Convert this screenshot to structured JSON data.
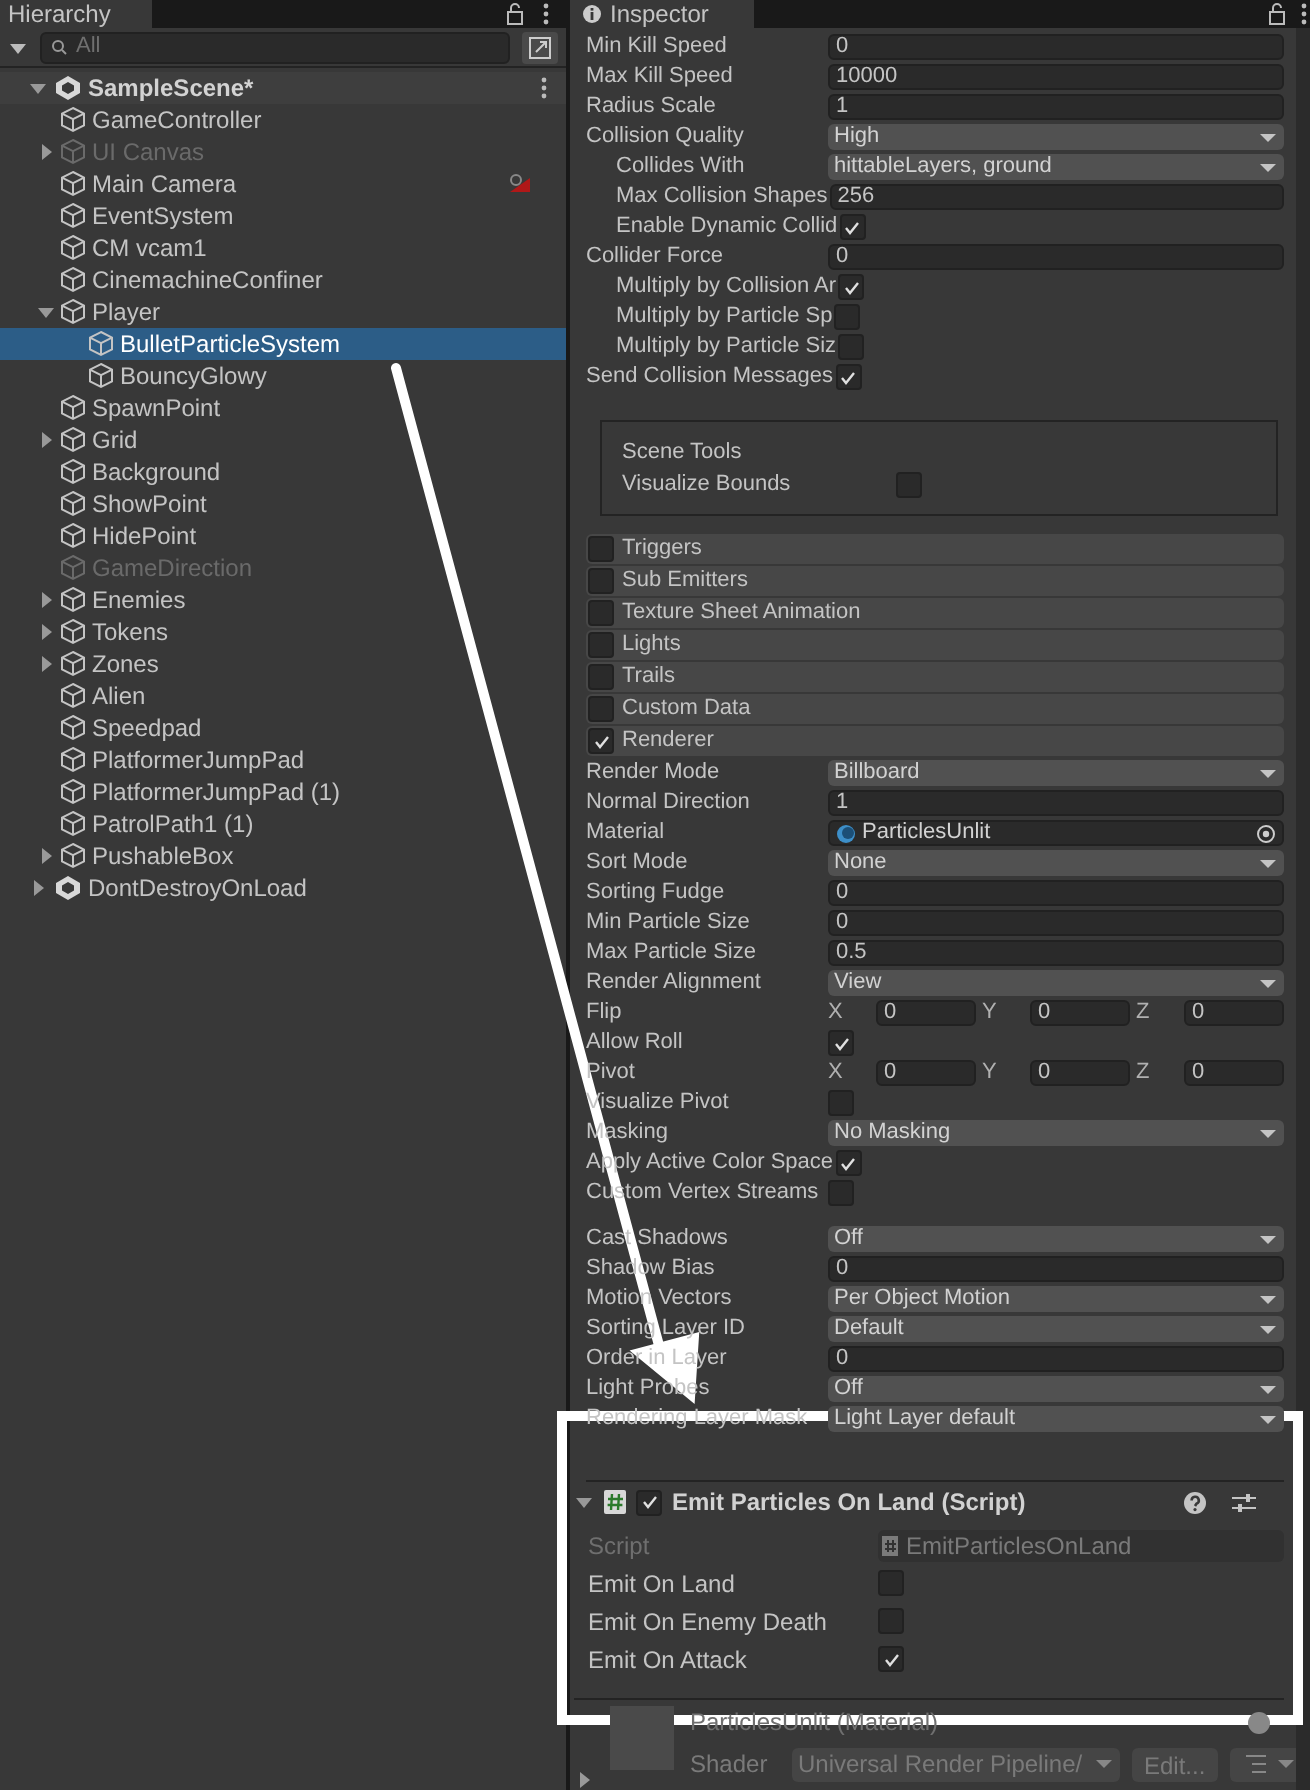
{
  "hierarchy": {
    "title": "Hierarchy",
    "search": {
      "placeholder": "All"
    },
    "scenes": [
      {
        "name": "SampleScene*",
        "expanded": true,
        "children": [
          {
            "name": "GameController",
            "disabled": false,
            "expandable": false,
            "selected": false
          },
          {
            "name": "UI Canvas",
            "disabled": true,
            "expandable": true,
            "expanded": false,
            "selected": false
          },
          {
            "name": "Main Camera",
            "disabled": false,
            "expandable": false,
            "selected": false,
            "gizmo_icon": true
          },
          {
            "name": "EventSystem",
            "disabled": false,
            "expandable": false,
            "selected": false
          },
          {
            "name": "CM vcam1",
            "disabled": false,
            "expandable": false,
            "selected": false
          },
          {
            "name": "CinemachineConfiner",
            "disabled": false,
            "expandable": false,
            "selected": false
          },
          {
            "name": "Player",
            "disabled": false,
            "expandable": true,
            "expanded": true,
            "selected": false,
            "children": [
              {
                "name": "BulletParticleSystem",
                "disabled": false,
                "expandable": false,
                "selected": true
              },
              {
                "name": "BouncyGlowy",
                "disabled": false,
                "expandable": false,
                "selected": false
              }
            ]
          },
          {
            "name": "SpawnPoint",
            "disabled": false,
            "expandable": false,
            "selected": false
          },
          {
            "name": "Grid",
            "disabled": false,
            "expandable": true,
            "expanded": false,
            "selected": false
          },
          {
            "name": "Background",
            "disabled": false,
            "expandable": false,
            "selected": false
          },
          {
            "name": "ShowPoint",
            "disabled": false,
            "expandable": false,
            "selected": false
          },
          {
            "name": "HidePoint",
            "disabled": false,
            "expandable": false,
            "selected": false
          },
          {
            "name": "GameDirection",
            "disabled": true,
            "expandable": false,
            "selected": false
          },
          {
            "name": "Enemies",
            "disabled": false,
            "expandable": true,
            "expanded": false,
            "selected": false
          },
          {
            "name": "Tokens",
            "disabled": false,
            "expandable": true,
            "expanded": false,
            "selected": false
          },
          {
            "name": "Zones",
            "disabled": false,
            "expandable": true,
            "expanded": false,
            "selected": false
          },
          {
            "name": "Alien",
            "disabled": false,
            "expandable": false,
            "selected": false
          },
          {
            "name": "Speedpad",
            "disabled": false,
            "expandable": false,
            "selected": false
          },
          {
            "name": "PlatformerJumpPad",
            "disabled": false,
            "expandable": false,
            "selected": false
          },
          {
            "name": "PlatformerJumpPad (1)",
            "disabled": false,
            "expandable": false,
            "selected": false
          },
          {
            "name": "PatrolPath1 (1)",
            "disabled": false,
            "expandable": false,
            "selected": false
          },
          {
            "name": "PushableBox",
            "disabled": false,
            "expandable": true,
            "expanded": false,
            "selected": false
          }
        ]
      },
      {
        "name": "DontDestroyOnLoad",
        "expanded": false
      }
    ]
  },
  "inspector": {
    "title": "Inspector",
    "rows": [
      {
        "kind": "field",
        "label": "Min Kill Speed",
        "value": "0",
        "indent": false
      },
      {
        "kind": "field",
        "label": "Max Kill Speed",
        "value": "10000",
        "indent": false
      },
      {
        "kind": "field",
        "label": "Radius Scale",
        "value": "1",
        "indent": false
      },
      {
        "kind": "dropdown",
        "label": "Collision Quality",
        "value": "High",
        "indent": false
      },
      {
        "kind": "dropdown",
        "label": "Collides With",
        "value": "hittableLayers, ground",
        "indent": true
      },
      {
        "kind": "field",
        "label": "Max Collision Shapes",
        "value": "256",
        "indent": true
      },
      {
        "kind": "checkbox",
        "label": "Enable Dynamic Collid",
        "checked": true,
        "indent": true
      },
      {
        "kind": "field",
        "label": "Collider Force",
        "value": "0",
        "indent": false
      },
      {
        "kind": "checkbox",
        "label": "Multiply by Collision Ar",
        "checked": true,
        "indent": true
      },
      {
        "kind": "checkbox",
        "label": "Multiply by Particle Sp",
        "checked": false,
        "indent": true
      },
      {
        "kind": "checkbox",
        "label": "Multiply by Particle Siz",
        "checked": false,
        "indent": true
      },
      {
        "kind": "checkbox",
        "label": "Send Collision Messages",
        "checked": true,
        "indent": false
      },
      {
        "kind": "group",
        "title": "Scene Tools",
        "label": "Visualize Bounds",
        "checked": false
      },
      {
        "kind": "module",
        "label": "Triggers",
        "checked": false
      },
      {
        "kind": "module",
        "label": "Sub Emitters",
        "checked": false
      },
      {
        "kind": "module",
        "label": "Texture Sheet Animation",
        "checked": false
      },
      {
        "kind": "module",
        "label": "Lights",
        "checked": false
      },
      {
        "kind": "module",
        "label": "Trails",
        "checked": false
      },
      {
        "kind": "module",
        "label": "Custom Data",
        "checked": false
      },
      {
        "kind": "module",
        "label": "Renderer",
        "checked": true
      },
      {
        "kind": "dropdown",
        "label": "Render Mode",
        "value": "Billboard",
        "indent": false
      },
      {
        "kind": "field",
        "label": "Normal Direction",
        "value": "1",
        "indent": false
      },
      {
        "kind": "object",
        "label": "Material",
        "value": "ParticlesUnlit",
        "indent": false
      },
      {
        "kind": "dropdown",
        "label": "Sort Mode",
        "value": "None",
        "indent": false
      },
      {
        "kind": "field",
        "label": "Sorting Fudge",
        "value": "0",
        "indent": false
      },
      {
        "kind": "field",
        "label": "Min Particle Size",
        "value": "0",
        "indent": false
      },
      {
        "kind": "field",
        "label": "Max Particle Size",
        "value": "0.5",
        "indent": false
      },
      {
        "kind": "dropdown",
        "label": "Render Alignment",
        "value": "View",
        "indent": false
      },
      {
        "kind": "vector",
        "label": "Flip",
        "axes": [
          {
            "axis": "X",
            "value": "0"
          },
          {
            "axis": "Y",
            "value": "0"
          },
          {
            "axis": "Z",
            "value": "0"
          }
        ]
      },
      {
        "kind": "checkbox",
        "label": "Allow Roll",
        "checked": true,
        "indent": false
      },
      {
        "kind": "vector",
        "label": "Pivot",
        "axes": [
          {
            "axis": "X",
            "value": "0"
          },
          {
            "axis": "Y",
            "value": "0"
          },
          {
            "axis": "Z",
            "value": "0"
          }
        ]
      },
      {
        "kind": "checkbox",
        "label": "Visualize Pivot",
        "checked": false,
        "indent": false
      },
      {
        "kind": "dropdown",
        "label": "Masking",
        "value": "No Masking",
        "indent": false
      },
      {
        "kind": "checkbox",
        "label": "Apply Active Color Space",
        "checked": true,
        "indent": false
      },
      {
        "kind": "checkbox",
        "label": "Custom Vertex Streams",
        "checked": false,
        "indent": false
      },
      {
        "kind": "spacer"
      },
      {
        "kind": "dropdown",
        "label": "Cast Shadows",
        "value": "Off",
        "indent": false
      },
      {
        "kind": "field",
        "label": "Shadow Bias",
        "value": "0",
        "indent": false
      },
      {
        "kind": "dropdown",
        "label": "Motion Vectors",
        "value": "Per Object Motion",
        "indent": false
      },
      {
        "kind": "dropdown",
        "label": "Sorting Layer ID",
        "value": "Default",
        "indent": false
      },
      {
        "kind": "field",
        "label": "Order in Layer",
        "value": "0",
        "indent": false
      },
      {
        "kind": "dropdown",
        "label": "Light Probes",
        "value": "Off",
        "indent": false
      },
      {
        "kind": "dropdown",
        "label": "Rendering Layer Mask",
        "value": "Light Layer default",
        "indent": false
      }
    ],
    "component": {
      "title": "Emit Particles On Land (Script)",
      "enabled": true,
      "expanded": true,
      "script": {
        "label": "Script",
        "value": "EmitParticlesOnLand"
      },
      "toggles": [
        {
          "label": "Emit On Land",
          "checked": false
        },
        {
          "label": "Emit On Enemy Death",
          "checked": false
        },
        {
          "label": "Emit On Attack",
          "checked": true
        }
      ]
    },
    "material": {
      "name": "ParticlesUnlit (Material)",
      "shader_label": "Shader",
      "shader": "Universal Render Pipeline/",
      "edit_button": "Edit..."
    }
  }
}
